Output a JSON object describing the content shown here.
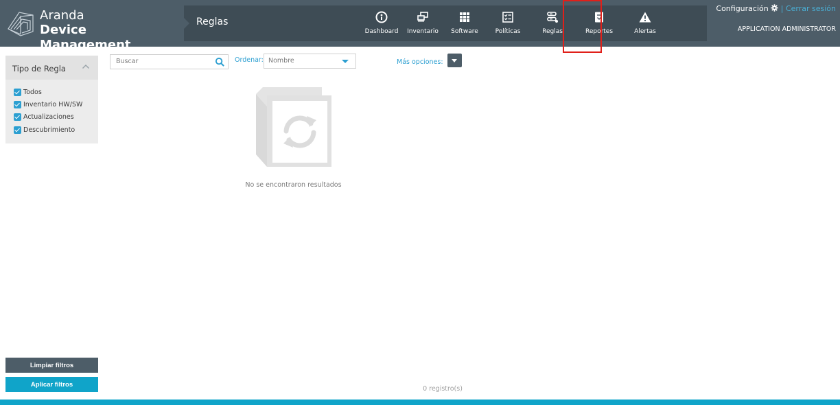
{
  "header": {
    "logo_line1": "Aranda",
    "logo_line2": "Device Management",
    "section_title": "Reglas",
    "config_label": "Configuración",
    "logout_label": "Cerrar sesión",
    "separator": "|",
    "user_name": "APPLICATION ADMINISTRATOR"
  },
  "nav": {
    "items": [
      {
        "label": "Dashboard",
        "icon": "dashboard-icon"
      },
      {
        "label": "Inventario",
        "icon": "inventory-icon"
      },
      {
        "label": "Software",
        "icon": "grid-icon"
      },
      {
        "label": "Políticas",
        "icon": "checklist-icon"
      },
      {
        "label": "Reglas",
        "icon": "rules-icon"
      },
      {
        "label": "Reportes",
        "icon": "report-icon"
      },
      {
        "label": "Alertas",
        "icon": "warning-icon"
      }
    ],
    "active": "Reglas"
  },
  "filters": {
    "title": "Tipo de Regla",
    "options": [
      {
        "label": "Todos",
        "checked": true
      },
      {
        "label": "Inventario HW/SW",
        "checked": true
      },
      {
        "label": "Actualizaciones",
        "checked": true
      },
      {
        "label": "Descubrimiento",
        "checked": true
      }
    ],
    "clear_label": "Limpiar filtros",
    "apply_label": "Aplicar filtros"
  },
  "toolbar": {
    "search_placeholder": "Buscar",
    "order_label": "Ordenar:",
    "order_value": "Nombre",
    "more_label": "Más opciones:"
  },
  "results": {
    "empty_text": "No se encontraron resultados",
    "count_text": "0 registro(s)"
  },
  "colors": {
    "header_bg": "#4d5d68",
    "accent": "#10a4c9",
    "link": "#2c9fd1",
    "highlight": "#e0201a"
  }
}
